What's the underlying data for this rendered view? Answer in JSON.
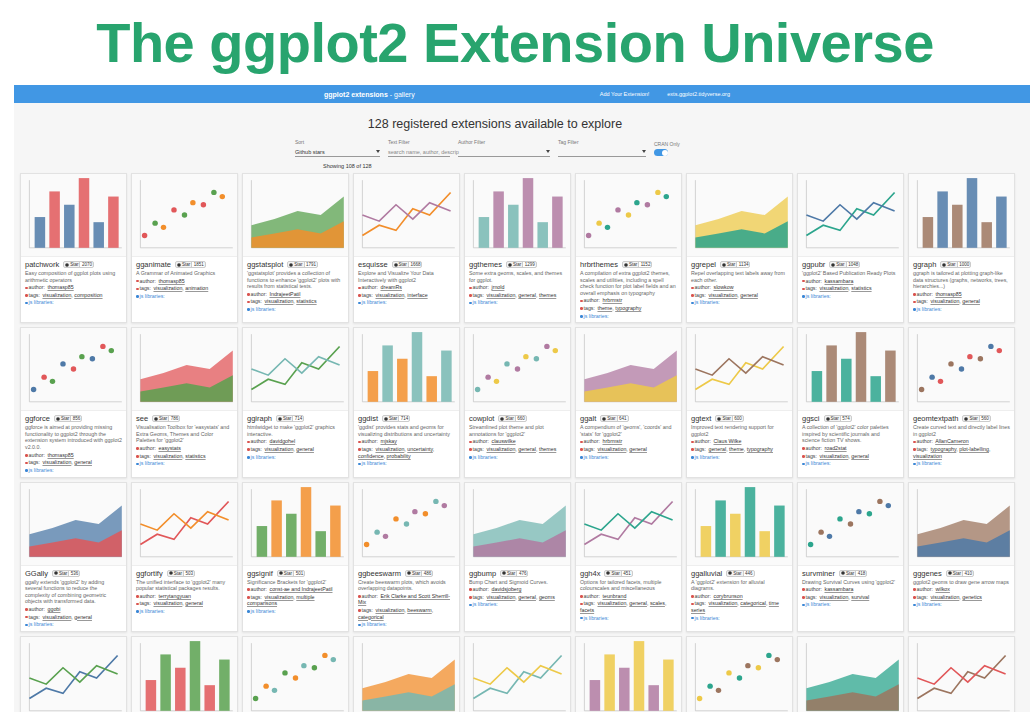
{
  "title": "The ggplot2 Extension Universe",
  "navbar": {
    "brand": "ggplot2 extensions",
    "subtitle": "- gallery",
    "links": [
      "Add Your Extension!",
      "exts.ggplot2.tidyverse.org"
    ]
  },
  "heading": "128 registered extensions available to explore",
  "filters": {
    "sort": {
      "label": "Sort",
      "value": "Github stars"
    },
    "text": {
      "label": "Text Filter",
      "placeholder": "search name, author, descrip"
    },
    "author": {
      "label": "Author Filter",
      "value": ""
    },
    "tag": {
      "label": "Tag Filter",
      "value": ""
    },
    "cran": {
      "label": "CRAN Only",
      "on": true
    }
  },
  "showing": "Showing 108 of 128",
  "labels": {
    "star": "Star",
    "author": "author:",
    "tags": "tags:",
    "js": "js libraries:",
    "separator": ", "
  },
  "cards": [
    {
      "kind": "full",
      "name": "patchwork",
      "stars": "2070",
      "description": "Easy composition of ggplot plots using arithmetic operators",
      "author": "thomasp85",
      "tags": [
        "visualization",
        "composition"
      ]
    },
    {
      "kind": "full",
      "name": "gganimate",
      "stars": "1851",
      "description": "A Grammar of Animated Graphics",
      "author": "thomasp85",
      "tags": [
        "visualization",
        "animation"
      ]
    },
    {
      "kind": "full",
      "name": "ggstatsplot",
      "stars": "1791",
      "description": "'ggstatsplot' provides a collection of functions to enhance 'ggplot2' plots with results from statistical tests.",
      "author": "IndrajeetPatil",
      "tags": [
        "visualization",
        "statistics"
      ]
    },
    {
      "kind": "full",
      "name": "esquisse",
      "stars": "1668",
      "description": "Explore and Visualize Your Data Interactively with ggplot2",
      "author": "dreamRs",
      "tags": [
        "visualization",
        "interface"
      ]
    },
    {
      "kind": "full",
      "name": "ggthemes",
      "stars": "1299",
      "description": "Some extra geoms, scales, and themes for ggplot.",
      "author": "jrnold",
      "tags": [
        "visualization",
        "general",
        "themes"
      ]
    },
    {
      "kind": "full",
      "name": "hrbrthemes",
      "stars": "1152",
      "description": "A compilation of extra ggplot2 themes, scales and utilities, including a spell check function for plot label fields and an overall emphasis on typography",
      "author": "hrbrmstr",
      "tags": [
        "theme",
        "typography"
      ]
    },
    {
      "kind": "full",
      "name": "ggrepel",
      "stars": "1134",
      "description": "Repel overlapping text labels away from each other.",
      "author": "slowkow",
      "tags": [
        "visualization",
        "general"
      ]
    },
    {
      "kind": "full",
      "name": "ggpubr",
      "stars": "1048",
      "description": "'ggplot2' Based Publication Ready Plots",
      "author": "kassambara",
      "tags": [
        "visualization",
        "statistics"
      ]
    },
    {
      "kind": "full",
      "name": "ggraph",
      "stars": "1000",
      "description": "ggraph is tailored at plotting graph-like data structures (graphs, networks, trees, hierarchies...)",
      "author": "thomasp85",
      "tags": [
        "visualization",
        "general"
      ]
    },
    {
      "kind": "full",
      "name": "ggforce",
      "stars": "856",
      "description": "ggforce is aimed at providing missing functionality to ggplot2 through the extension system introduced with ggplot2 v2.0.0.",
      "author": "thomasp85",
      "tags": [
        "visualization",
        "general"
      ]
    },
    {
      "kind": "full",
      "name": "see",
      "stars": "786",
      "description": "Visualisation Toolbox for 'easystats' and Extra Geoms, Themes and Color Palettes for 'ggplot2'",
      "author": "easystats",
      "tags": [
        "visualization",
        "statistics"
      ]
    },
    {
      "kind": "full",
      "name": "ggiraph",
      "stars": "714",
      "description": "htmlwidget to make 'ggplot2' graphics interactive.",
      "author": "davidgohel",
      "tags": [
        "visualization",
        "general"
      ]
    },
    {
      "kind": "full",
      "name": "ggdist",
      "stars": "714",
      "description": "'ggdist' provides stats and geoms for visualizing distributions and uncertainty",
      "author": "mjskay",
      "tags": [
        "visualization",
        "uncertainty",
        "confidence",
        "probability"
      ]
    },
    {
      "kind": "full",
      "name": "cowplot",
      "stars": "660",
      "description": "Streamlined plot theme and plot annotations for 'ggplot2'",
      "author": "clauswilke",
      "tags": [
        "visualization",
        "general",
        "themes"
      ]
    },
    {
      "kind": "full",
      "name": "ggalt",
      "stars": "641",
      "description": "A compendium of 'geoms', 'coords' and 'stats' for 'ggplot2'",
      "author": "hrbrmstr",
      "tags": [
        "visualization",
        "general"
      ]
    },
    {
      "kind": "full",
      "name": "ggtext",
      "stars": "600",
      "description": "Improved text rendering support for ggplot2",
      "author": "Claus Wilke",
      "tags": [
        "general",
        "theme",
        "typography"
      ]
    },
    {
      "kind": "full",
      "name": "ggsci",
      "stars": "574",
      "description": "A collection of 'ggplot2' color palettes inspired by scientific journals and science fiction TV shows.",
      "author": "road2stat",
      "tags": [
        "visualization",
        "general"
      ]
    },
    {
      "kind": "full",
      "name": "geomtextpath",
      "stars": "560",
      "description": "Create curved text and directly label lines in ggplot2",
      "author": "AllanCameron",
      "tags": [
        "typography",
        "plot-labelling",
        "visualization"
      ]
    },
    {
      "kind": "full",
      "name": "GGally",
      "stars": "536",
      "description": "ggally extends 'ggplot2' by adding several functions to reduce the complexity of combining geometric objects with transformed data.",
      "author": "ggobi",
      "tags": [
        "visualization",
        "general"
      ]
    },
    {
      "kind": "full",
      "name": "ggfortify",
      "stars": "503",
      "description": "The unified interface to 'ggplot2' many popular statistical packages results.",
      "author": "terrytangyuan",
      "tags": [
        "visualization",
        "general"
      ]
    },
    {
      "kind": "full",
      "name": "ggsignif",
      "stars": "501",
      "description": "Significance Brackets for 'ggplot2'",
      "author": "const-ae and IndrajeetPatil",
      "tags": [
        "visualization",
        "multiple comparisons"
      ]
    },
    {
      "kind": "full",
      "name": "ggbeeswarm",
      "stars": "486",
      "description": "Create beeswarm plots, which avoids overlapping datapoints.",
      "author": "Erik Clarke and Scott Sherrill-Mix",
      "tags": [
        "visualization",
        "beeswarm",
        "categorical"
      ]
    },
    {
      "kind": "full",
      "name": "ggbump",
      "stars": "476",
      "description": "Bump Chart and Sigmoid Curves.",
      "author": "davidsjoberg",
      "tags": [
        "visualization",
        "general",
        "geoms"
      ]
    },
    {
      "kind": "full",
      "name": "ggh4x",
      "stars": "451",
      "description": "Options for tailored facets, multiple colourscales and miscellaneous",
      "author": "teunbrand",
      "tags": [
        "visualization",
        "general",
        "scales",
        "facets"
      ]
    },
    {
      "kind": "full",
      "name": "ggalluvial",
      "stars": "446",
      "description": "A 'ggplot2' extension for alluvial diagrams.",
      "author": "corybrunson",
      "tags": [
        "visualization",
        "categorical",
        "time series"
      ]
    },
    {
      "kind": "full",
      "name": "survminer",
      "stars": "418",
      "description": "Drawing Survival Curves using 'ggplot2'",
      "author": "kassambara",
      "tags": [
        "visualization",
        "survival"
      ]
    },
    {
      "kind": "full",
      "name": "gggenes",
      "stars": "410",
      "description": "ggplot2 geoms to draw gene arrow maps",
      "author": "wilkox",
      "tags": [
        "visualization",
        "genetics"
      ]
    },
    {
      "kind": "thumbnail"
    },
    {
      "kind": "thumbnail"
    },
    {
      "kind": "thumbnail"
    },
    {
      "kind": "thumbnail"
    },
    {
      "kind": "thumbnail"
    },
    {
      "kind": "thumbnail"
    },
    {
      "kind": "thumbnail"
    },
    {
      "kind": "thumbnail"
    },
    {
      "kind": "thumbnail"
    }
  ]
}
